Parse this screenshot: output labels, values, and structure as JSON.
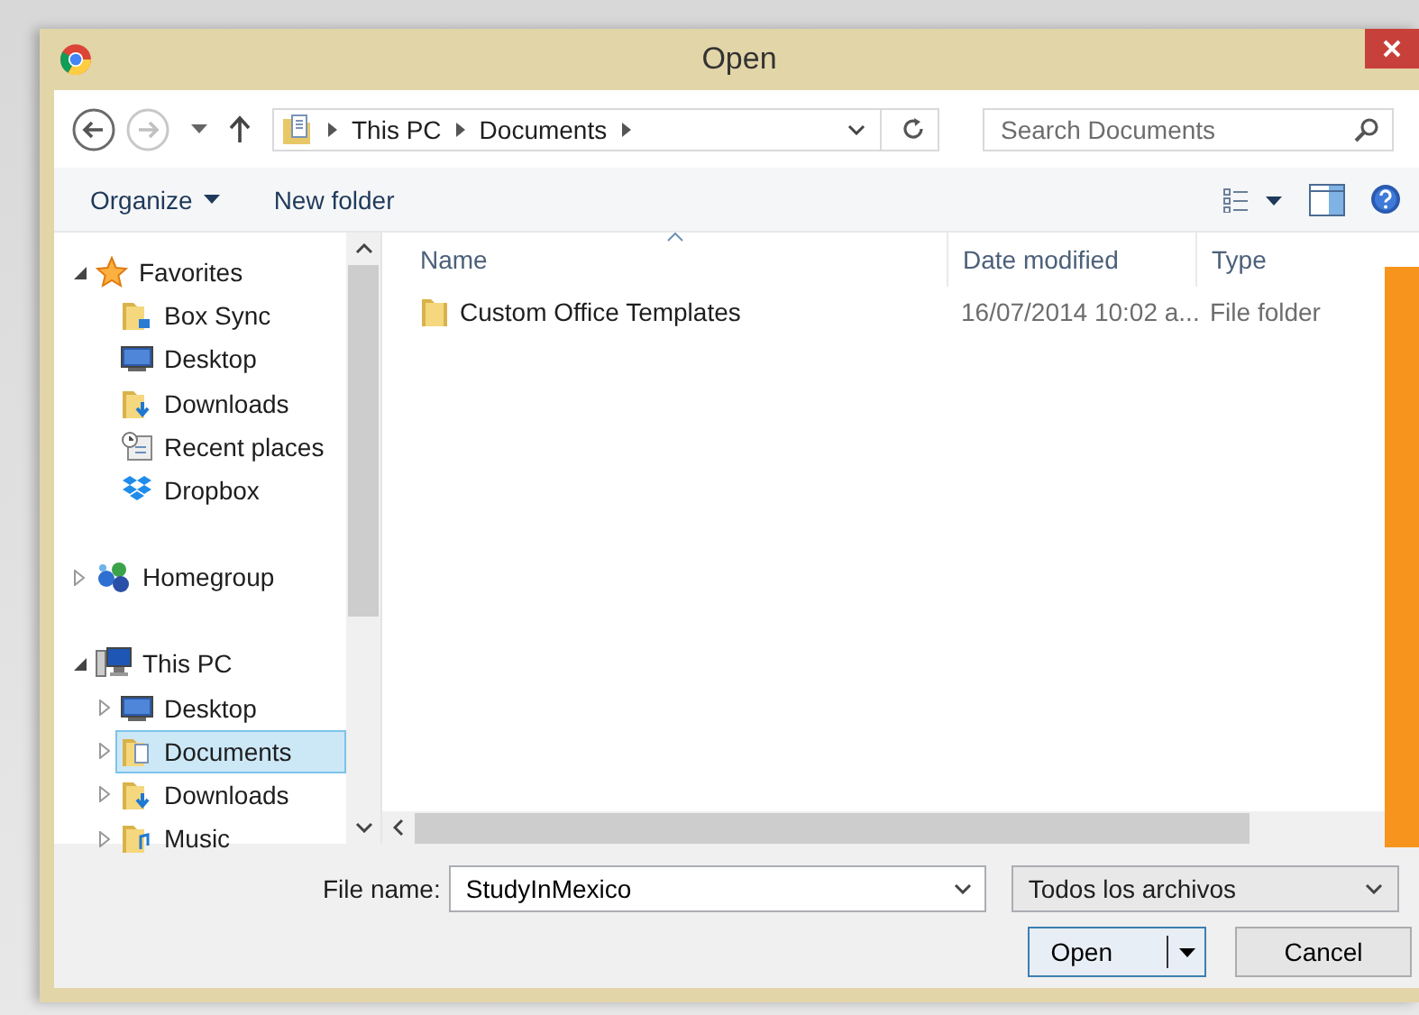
{
  "window": {
    "title": "Open"
  },
  "address_bar": {
    "path": [
      "This PC",
      "Documents"
    ]
  },
  "search": {
    "placeholder": "Search Documents"
  },
  "toolbar": {
    "organize": "Organize",
    "new_folder": "New folder"
  },
  "nav_tree": [
    {
      "label": "Favorites",
      "kind": "star",
      "expanded": true,
      "selected": false,
      "children": [
        {
          "label": "Box Sync",
          "kind": "folder",
          "selected": false
        },
        {
          "label": "Desktop",
          "kind": "desktop",
          "selected": false
        },
        {
          "label": "Downloads",
          "kind": "downloads",
          "selected": false
        },
        {
          "label": "Recent places",
          "kind": "recent",
          "selected": false
        },
        {
          "label": "Dropbox",
          "kind": "dropbox",
          "selected": false
        }
      ]
    },
    {
      "label": "Homegroup",
      "kind": "homegroup",
      "expanded": false,
      "selected": false
    },
    {
      "label": "This PC",
      "kind": "pc",
      "expanded": true,
      "selected": false,
      "children": [
        {
          "label": "Desktop",
          "kind": "desktop",
          "expanded": false,
          "selected": false
        },
        {
          "label": "Documents",
          "kind": "documents",
          "expanded": false,
          "selected": true
        },
        {
          "label": "Downloads",
          "kind": "downloads",
          "expanded": false,
          "selected": false
        },
        {
          "label": "Music",
          "kind": "music",
          "expanded": false,
          "selected": false
        }
      ]
    }
  ],
  "file_list": {
    "columns": [
      "Name",
      "Date modified",
      "Type"
    ],
    "rows": [
      {
        "name": "Custom Office Templates",
        "date_modified": "16/07/2014 10:02 a...",
        "type": "File folder",
        "selected": false
      }
    ]
  },
  "file_name": {
    "label": "File name:",
    "value": "StudyInMexico"
  },
  "file_type": {
    "value": "Todos los archivos"
  },
  "buttons": {
    "open": "Open",
    "cancel": "Cancel"
  }
}
